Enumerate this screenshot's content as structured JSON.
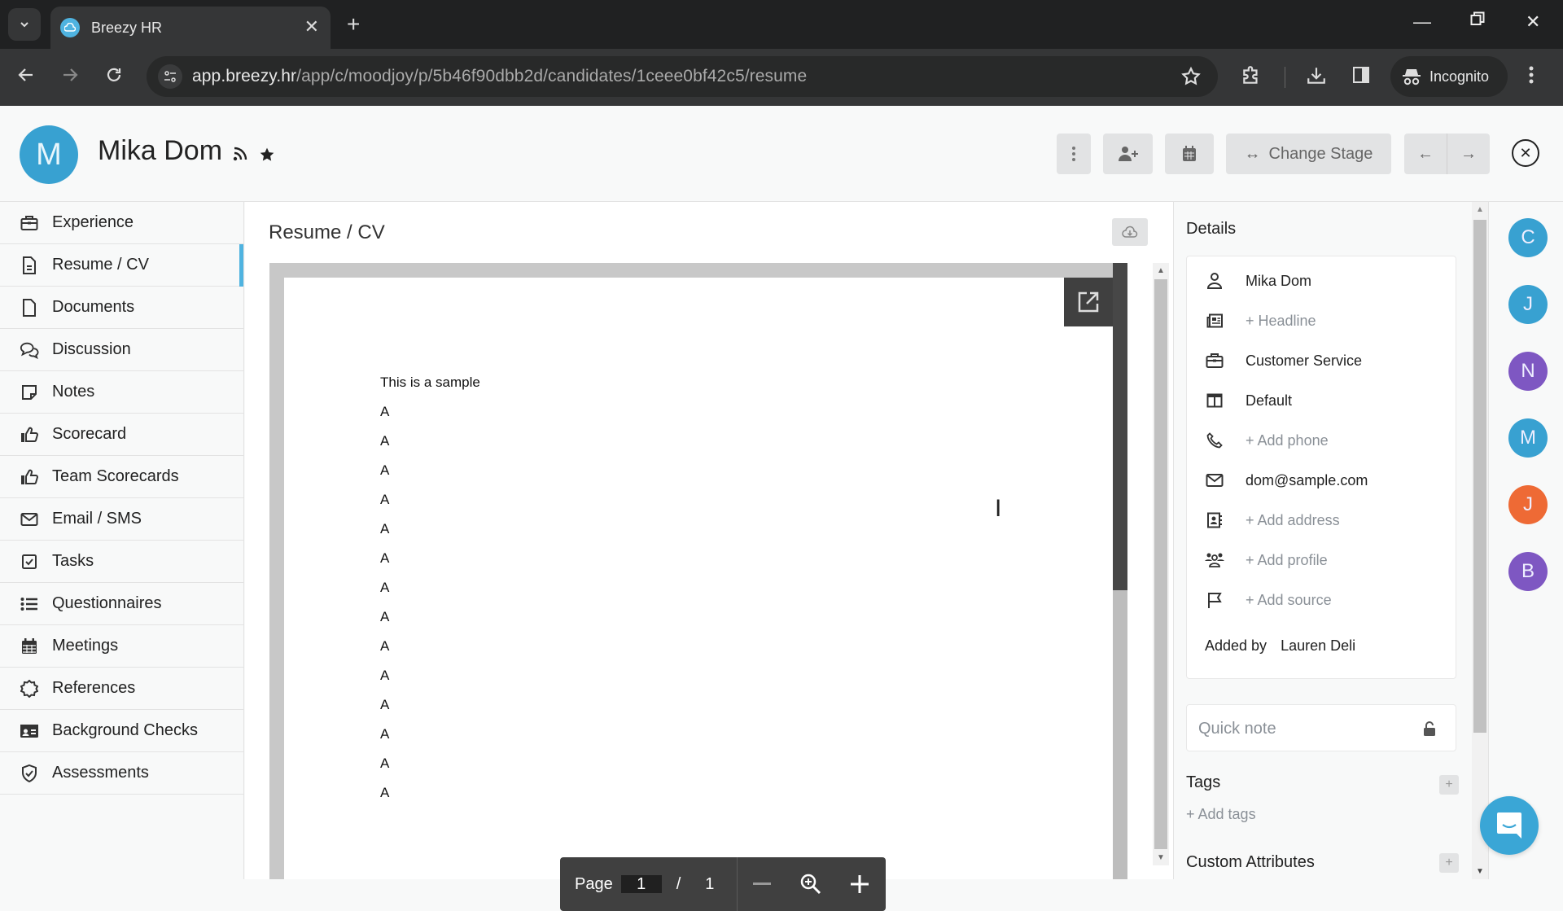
{
  "browser": {
    "tab_title": "Breezy HR",
    "url_host": "app.breezy.hr",
    "url_path": "/app/c/moodjoy/p/5b46f90dbb2d/candidates/1ceee0bf42c5/resume",
    "incognito_label": "Incognito"
  },
  "header": {
    "avatar_initial": "M",
    "candidate_name": "Mika Dom",
    "change_stage_label": "Change Stage"
  },
  "sidebar": {
    "items": [
      {
        "label": "Experience",
        "icon": "briefcase-icon"
      },
      {
        "label": "Resume / CV",
        "icon": "file-text-icon",
        "active": true
      },
      {
        "label": "Documents",
        "icon": "file-icon"
      },
      {
        "label": "Discussion",
        "icon": "comments-icon"
      },
      {
        "label": "Notes",
        "icon": "sticky-note-icon"
      },
      {
        "label": "Scorecard",
        "icon": "thumbs-up-icon"
      },
      {
        "label": "Team Scorecards",
        "icon": "thumbs-up-icon"
      },
      {
        "label": "Email / SMS",
        "icon": "envelope-icon"
      },
      {
        "label": "Tasks",
        "icon": "check-square-icon"
      },
      {
        "label": "Questionnaires",
        "icon": "list-icon"
      },
      {
        "label": "Meetings",
        "icon": "calendar-icon"
      },
      {
        "label": "References",
        "icon": "badge-icon"
      },
      {
        "label": "Background Checks",
        "icon": "id-card-icon"
      },
      {
        "label": "Assessments",
        "icon": "shield-check-icon"
      }
    ]
  },
  "main": {
    "title": "Resume / CV",
    "document": {
      "heading": "This is a sample",
      "lines": [
        "A",
        "A",
        "A",
        "A",
        "A",
        "A",
        "A",
        "A",
        "A",
        "A",
        "A",
        "A",
        "A",
        "A"
      ]
    },
    "pdf_controls": {
      "page_label": "Page",
      "current_page": "1",
      "separator": "/",
      "total_pages": "1"
    }
  },
  "details": {
    "title": "Details",
    "rows": [
      {
        "icon": "user-icon",
        "text": "Mika Dom",
        "placeholder": false
      },
      {
        "icon": "newspaper-icon",
        "text": "+ Headline",
        "placeholder": true
      },
      {
        "icon": "briefcase-icon",
        "text": "Customer Service",
        "placeholder": false
      },
      {
        "icon": "columns-icon",
        "text": "Default",
        "placeholder": false
      },
      {
        "icon": "phone-icon",
        "text": "+ Add phone",
        "placeholder": true
      },
      {
        "icon": "envelope-icon",
        "text": "dom@sample.com",
        "placeholder": false
      },
      {
        "icon": "address-book-icon",
        "text": "+ Add address",
        "placeholder": true
      },
      {
        "icon": "users-icon",
        "text": "+ Add profile",
        "placeholder": true
      },
      {
        "icon": "flag-icon",
        "text": "+ Add source",
        "placeholder": true
      }
    ],
    "added_by_label": "Added by",
    "added_by_name": "Lauren Deli",
    "quick_note_placeholder": "Quick note",
    "tags_title": "Tags",
    "add_tags_label": "+ Add tags",
    "custom_attributes_title": "Custom Attributes"
  },
  "team_rail": {
    "avatars": [
      {
        "initial": "C",
        "color": "#38a1d1"
      },
      {
        "initial": "J",
        "color": "#38a1d1"
      },
      {
        "initial": "N",
        "color": "#7e57c2"
      },
      {
        "initial": "M",
        "color": "#38a1d1"
      },
      {
        "initial": "J",
        "color": "#ee6a35"
      },
      {
        "initial": "B",
        "color": "#7e57c2"
      }
    ]
  },
  "colors": {
    "accent": "#4fb3e0",
    "avatar_blue": "#38a1d1",
    "avatar_purple": "#7e57c2",
    "avatar_orange": "#ee6a35"
  }
}
